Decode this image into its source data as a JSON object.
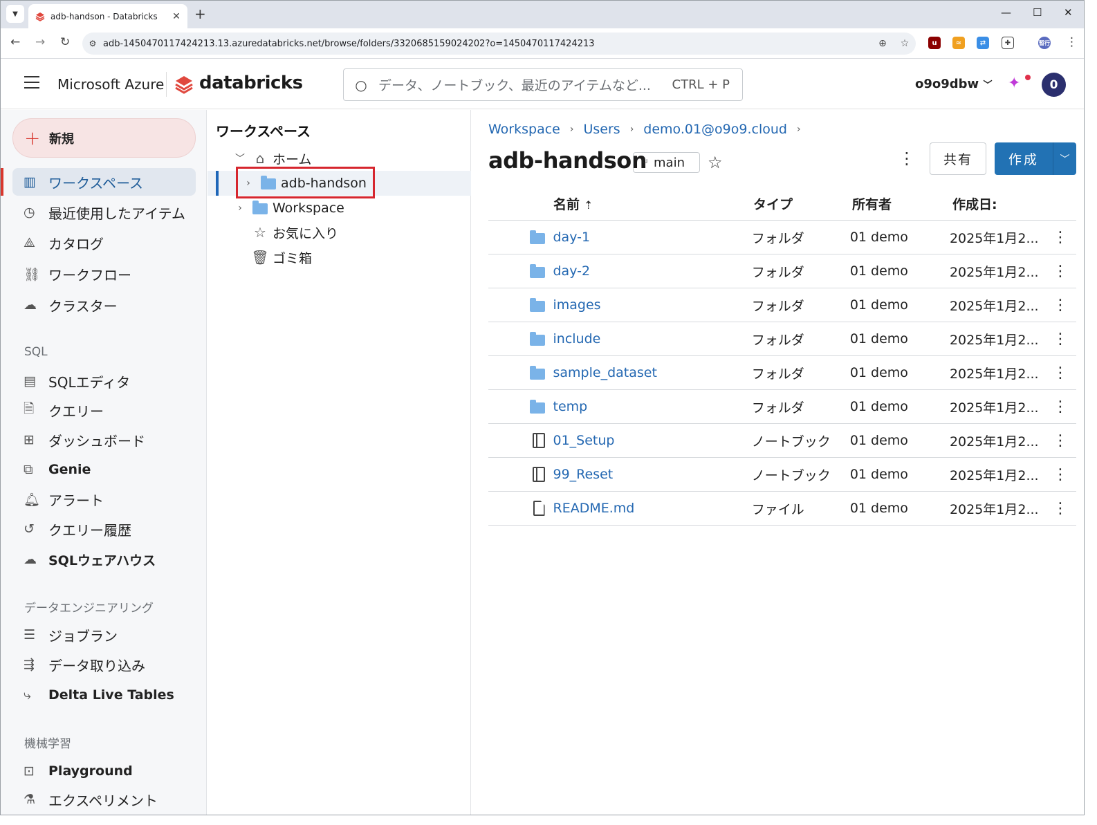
{
  "browser": {
    "tab_title": "adb-handson - Databricks",
    "url": "adb-1450470117424213.13.azuredatabricks.net/browse/folders/3320685159024202?o=1450470117424213",
    "profile_badge": "暂行"
  },
  "header": {
    "brand_azure": "Microsoft Azure",
    "brand_databricks": "databricks",
    "search_placeholder": "データ、ノートブック、最近のアイテムなど...",
    "search_shortcut": "CTRL + P",
    "workspace_name": "o9o9dbw",
    "avatar_letter": "0"
  },
  "sidebar": {
    "new_label": "新規",
    "items_main": [
      {
        "label": "ワークスペース",
        "icon": "workspace-icon"
      },
      {
        "label": "最近使用したアイテム",
        "icon": "clock-icon"
      },
      {
        "label": "カタログ",
        "icon": "catalog-icon"
      },
      {
        "label": "ワークフロー",
        "icon": "workflow-icon"
      },
      {
        "label": "クラスター",
        "icon": "cloud-icon"
      }
    ],
    "section_sql": "SQL",
    "items_sql": [
      {
        "label": "SQLエディタ",
        "icon": "sql-editor-icon"
      },
      {
        "label": "クエリー",
        "icon": "query-icon"
      },
      {
        "label": "ダッシュボード",
        "icon": "dashboard-icon"
      },
      {
        "label": "Genie",
        "icon": "genie-icon"
      },
      {
        "label": "アラート",
        "icon": "bell-icon"
      },
      {
        "label": "クエリー履歴",
        "icon": "history-icon"
      },
      {
        "label": "SQLウェアハウス",
        "icon": "warehouse-icon"
      }
    ],
    "section_de": "データエンジニアリング",
    "items_de": [
      {
        "label": "ジョブラン",
        "icon": "job-runs-icon"
      },
      {
        "label": "データ取り込み",
        "icon": "ingest-icon"
      },
      {
        "label": "Delta Live Tables",
        "icon": "dlt-icon"
      }
    ],
    "section_ml": "機械学習",
    "items_ml": [
      {
        "label": "Playground",
        "icon": "robot-icon"
      },
      {
        "label": "エクスペリメント",
        "icon": "flask-icon"
      }
    ]
  },
  "tree": {
    "title": "ワークスペース",
    "rows": [
      {
        "label": "ホーム",
        "icon": "home-icon"
      },
      {
        "label": "adb-handson",
        "icon": "git-folder-icon"
      },
      {
        "label": "Workspace",
        "icon": "folder-icon"
      },
      {
        "label": "お気に入り",
        "icon": "star-icon"
      },
      {
        "label": "ゴミ箱",
        "icon": "trash-icon"
      }
    ]
  },
  "content": {
    "breadcrumbs": [
      "Workspace",
      "Users",
      "demo.01@o9o9.cloud"
    ],
    "title": "adb-handson",
    "branch": "main",
    "share_label": "共有",
    "create_label": "作成",
    "columns": {
      "name": "名前",
      "type": "タイプ",
      "owner": "所有者",
      "created": "作成日:"
    },
    "rows": [
      {
        "name": "day-1",
        "type": "フォルダ",
        "owner": "01 demo",
        "created": "2025年1月2...",
        "kind": "folder"
      },
      {
        "name": "day-2",
        "type": "フォルダ",
        "owner": "01 demo",
        "created": "2025年1月2...",
        "kind": "folder"
      },
      {
        "name": "images",
        "type": "フォルダ",
        "owner": "01 demo",
        "created": "2025年1月2...",
        "kind": "folder"
      },
      {
        "name": "include",
        "type": "フォルダ",
        "owner": "01 demo",
        "created": "2025年1月2...",
        "kind": "folder"
      },
      {
        "name": "sample_dataset",
        "type": "フォルダ",
        "owner": "01 demo",
        "created": "2025年1月2...",
        "kind": "folder"
      },
      {
        "name": "temp",
        "type": "フォルダ",
        "owner": "01 demo",
        "created": "2025年1月2...",
        "kind": "folder"
      },
      {
        "name": "01_Setup",
        "type": "ノートブック",
        "owner": "01 demo",
        "created": "2025年1月2...",
        "kind": "notebook"
      },
      {
        "name": "99_Reset",
        "type": "ノートブック",
        "owner": "01 demo",
        "created": "2025年1月2...",
        "kind": "notebook"
      },
      {
        "name": "README.md",
        "type": "ファイル",
        "owner": "01 demo",
        "created": "2025年1月2...",
        "kind": "file"
      }
    ]
  },
  "colors": {
    "accent": "#2272b4",
    "brand_red": "#d8372e",
    "link": "#2468b2",
    "highlight_box": "#d6262e"
  }
}
